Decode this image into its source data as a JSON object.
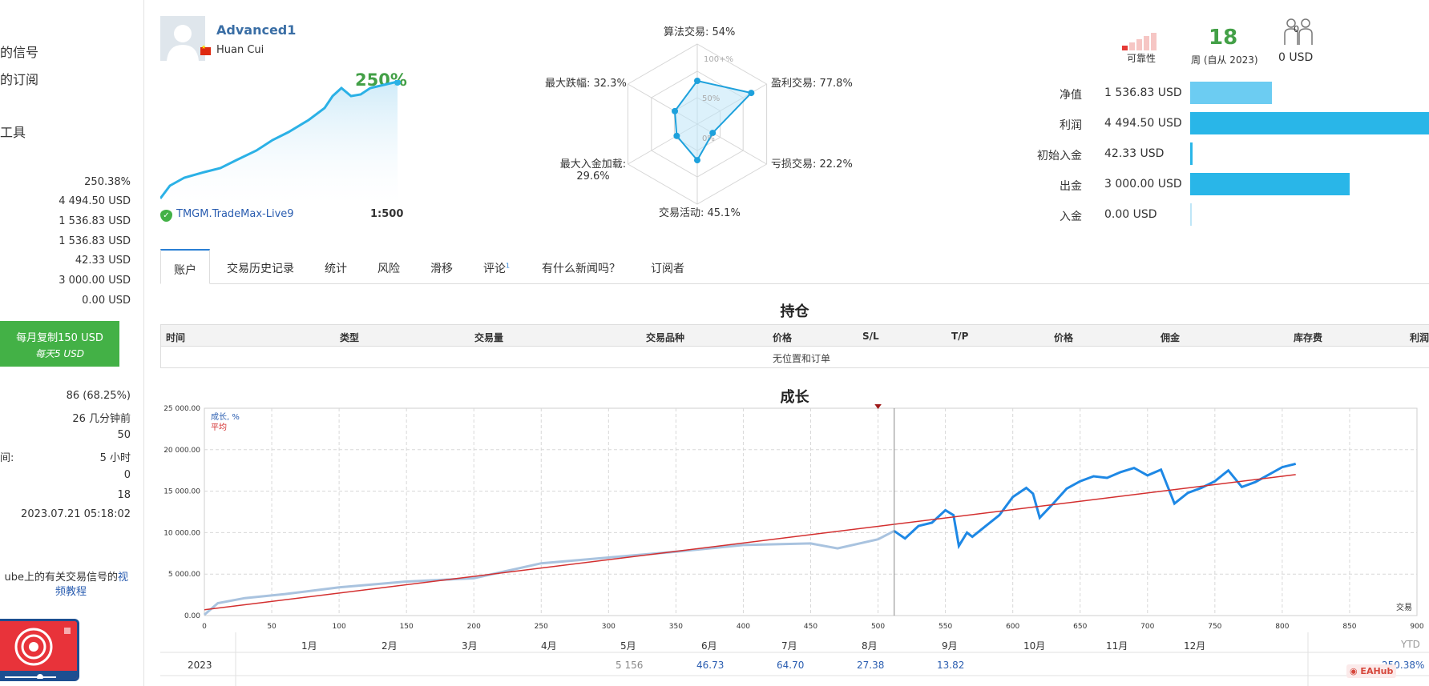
{
  "sidebar": {
    "nav": [
      {
        "label": "的信号"
      },
      {
        "label": "的订阅"
      },
      {
        "label": "工具"
      }
    ],
    "stats_top": [
      "250.38%",
      "4 494.50 USD",
      "1 536.83 USD",
      "1 536.83 USD",
      "42.33 USD",
      "3 000.00 USD",
      "0.00 USD"
    ],
    "copy_button": {
      "line1": "每月复制150 USD",
      "line2": "每天5 USD"
    },
    "stats_bottom": [
      {
        "label": "",
        "value": "86 (68.25%)"
      },
      {
        "label": "",
        "value": "26 几分钟前"
      },
      {
        "label": "",
        "value": "50"
      },
      {
        "label": "间:",
        "value": "5 小时"
      },
      {
        "label": "",
        "value": "0"
      },
      {
        "label": "",
        "value": "18"
      },
      {
        "label": "",
        "value": "2023.07.21 05:18:02"
      }
    ],
    "video_text_plain": "ube上的有关交易信号的",
    "video_text_link1": "视",
    "video_text_link2": "频教程"
  },
  "header": {
    "signal_name": "Advanced1",
    "author": "Huan Cui",
    "growth": "250%",
    "broker": "TMGM.TradeMax-Live9",
    "leverage": "1:500"
  },
  "radar": {
    "labels": {
      "algo": "算法交易: 54%",
      "profit": "盈利交易: 77.8%",
      "loss": "亏损交易: 22.2%",
      "activity": "交易活动: 45.1%",
      "deposit_load_1": "最大入金加载:",
      "deposit_load_2": "29.6%",
      "drawdown": "最大跌幅: 32.3%"
    },
    "ring_labels": {
      "outer": "100+%",
      "mid": "50%",
      "inner": "0%"
    },
    "values": {
      "algo": 54,
      "profit": 77.8,
      "loss": 22.2,
      "activity": 45.1,
      "deposit_load": 29.6,
      "drawdown": 32.3
    }
  },
  "metrics": {
    "reliability_label": "可靠性",
    "reliability_level": 1,
    "weeks": "18",
    "weeks_label": "周 (自从 2023)",
    "subscribers": "0",
    "subscription_usd": "0 USD",
    "balance": [
      {
        "label": "净值",
        "value": "1 536.83 USD",
        "amount": 1536.83,
        "color": "#6cccf2"
      },
      {
        "label": "利润",
        "value": "4 494.50 USD",
        "amount": 4494.5,
        "color": "#29b6e8"
      },
      {
        "label": "初始入金",
        "value": "42.33 USD",
        "amount": 42.33,
        "color": "#29b6e8"
      },
      {
        "label": "出金",
        "value": "3 000.00 USD",
        "amount": 3000,
        "color": "#29b6e8"
      },
      {
        "label": "入金",
        "value": "0.00 USD",
        "amount": 0,
        "color": "#29b6e8"
      }
    ]
  },
  "tabs": [
    "账户",
    "交易历史记录",
    "统计",
    "风险",
    "滑移",
    "评论",
    "有什么新闻吗？",
    "订阅者"
  ],
  "tab_badge": "1",
  "positions": {
    "title": "持仓",
    "columns": [
      "时间",
      "类型",
      "交易量",
      "交易品种",
      "价格",
      "S/L",
      "T/P",
      "价格",
      "佣金",
      "库存费",
      "利润"
    ],
    "empty": "无位置和订单"
  },
  "growth": {
    "title": "成长",
    "legend_growth": "成长, %",
    "legend_avg": "平均",
    "trades_label": "交易",
    "y_ticks": [
      "25 000.00",
      "20 000.00",
      "15 000.00",
      "10 000.00",
      "5 000.00",
      "0.00"
    ],
    "x_ticks": [
      "0",
      "50",
      "100",
      "150",
      "200",
      "250",
      "300",
      "350",
      "400",
      "450",
      "500",
      "550",
      "600",
      "650",
      "700",
      "750",
      "800",
      "850",
      "900"
    ],
    "year": "2023",
    "months": [
      "1月",
      "2月",
      "3月",
      "4月",
      "5月",
      "6月",
      "7月",
      "8月",
      "9月",
      "10月",
      "11月",
      "12月"
    ],
    "month_values": [
      "",
      "",
      "",
      "",
      "5 156",
      "46.73",
      "64.70",
      "27.38",
      "13.82",
      "",
      "",
      ""
    ],
    "ytd_label": "YTD",
    "ytd_value": "250.38%"
  },
  "chart_data": {
    "type": "line",
    "title": "成长",
    "xlabel": "交易",
    "ylabel": "",
    "xlim": [
      0,
      900
    ],
    "ylim": [
      0,
      25000
    ],
    "series": [
      {
        "name": "成长, %",
        "x": [
          0,
          10,
          30,
          60,
          100,
          150,
          200,
          250,
          300,
          350,
          400,
          450,
          470,
          500,
          512
        ],
        "values": [
          100,
          1500,
          2100,
          2600,
          3400,
          4100,
          4500,
          6300,
          7000,
          7700,
          8500,
          8700,
          8100,
          9200,
          10200
        ]
      },
      {
        "name": "成长, %",
        "x": [
          512,
          520,
          530,
          540,
          550,
          556,
          560,
          566,
          570,
          580,
          590,
          600,
          610,
          615,
          620,
          630,
          640,
          650,
          660,
          670,
          680,
          690,
          700,
          710,
          720,
          730,
          740,
          750,
          760,
          770,
          780,
          790,
          800,
          810
        ],
        "values": [
          10200,
          9300,
          10800,
          11200,
          12700,
          12100,
          8400,
          10000,
          9500,
          10800,
          12100,
          14300,
          15400,
          14700,
          11800,
          13500,
          15300,
          16200,
          16800,
          16600,
          17300,
          17800,
          16900,
          17600,
          13500,
          14800,
          15400,
          16200,
          17500,
          15500,
          16100,
          17000,
          17900,
          18300
        ]
      },
      {
        "name": "平均",
        "x": [
          0,
          810
        ],
        "values": [
          700,
          17000
        ]
      }
    ]
  }
}
